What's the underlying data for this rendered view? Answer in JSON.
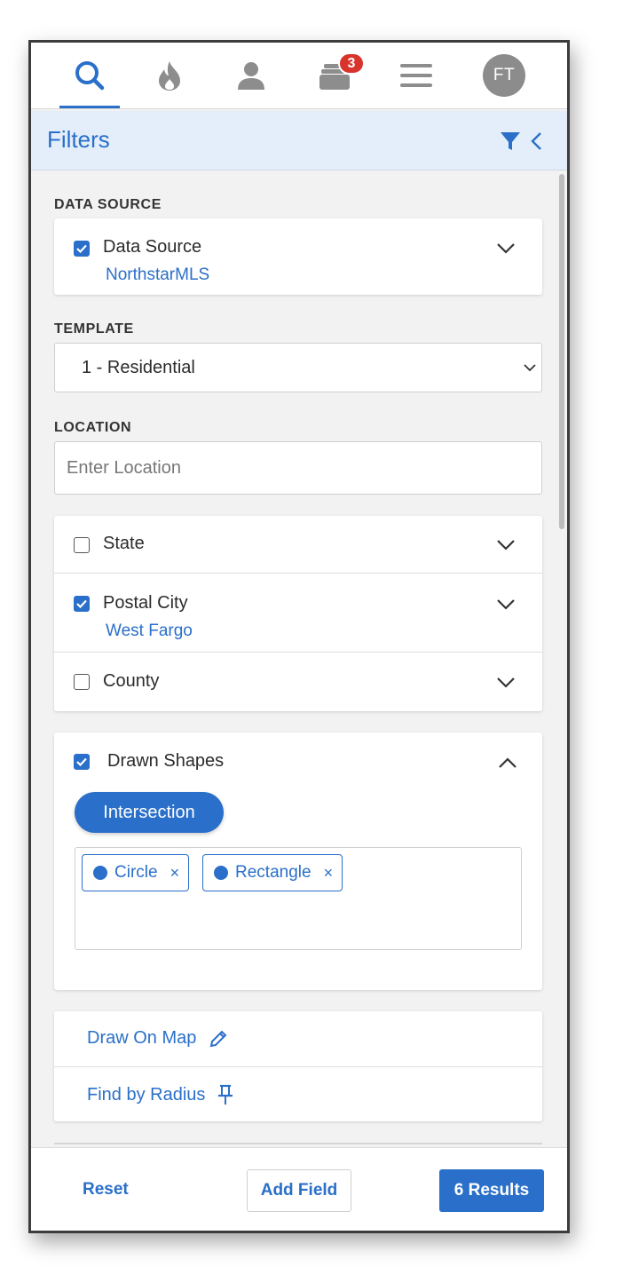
{
  "nav": {
    "badge_count": "3",
    "avatar_initials": "FT"
  },
  "header": {
    "title": "Filters"
  },
  "data_source": {
    "section_label": "DATA SOURCE",
    "title": "Data Source",
    "value": "NorthstarMLS"
  },
  "template": {
    "section_label": "TEMPLATE",
    "selected": "1 - Residential"
  },
  "location": {
    "section_label": "LOCATION",
    "placeholder": "Enter Location",
    "rows": [
      {
        "label": "State"
      },
      {
        "label": "Postal City",
        "value": "West Fargo"
      },
      {
        "label": "County"
      }
    ]
  },
  "drawn_shapes": {
    "title": "Drawn Shapes",
    "mode_label": "Intersection",
    "tags": [
      "Circle",
      "Rectangle"
    ],
    "remove_glyph": "×"
  },
  "links": {
    "draw_on_map": "Draw On Map",
    "find_by_radius": "Find by Radius"
  },
  "footer": {
    "reset": "Reset",
    "add_field": "Add Field",
    "results": "6 Results"
  },
  "colors": {
    "accent": "#2a6fc9",
    "badge": "#d9342b",
    "header_bg": "#e3eefa"
  }
}
